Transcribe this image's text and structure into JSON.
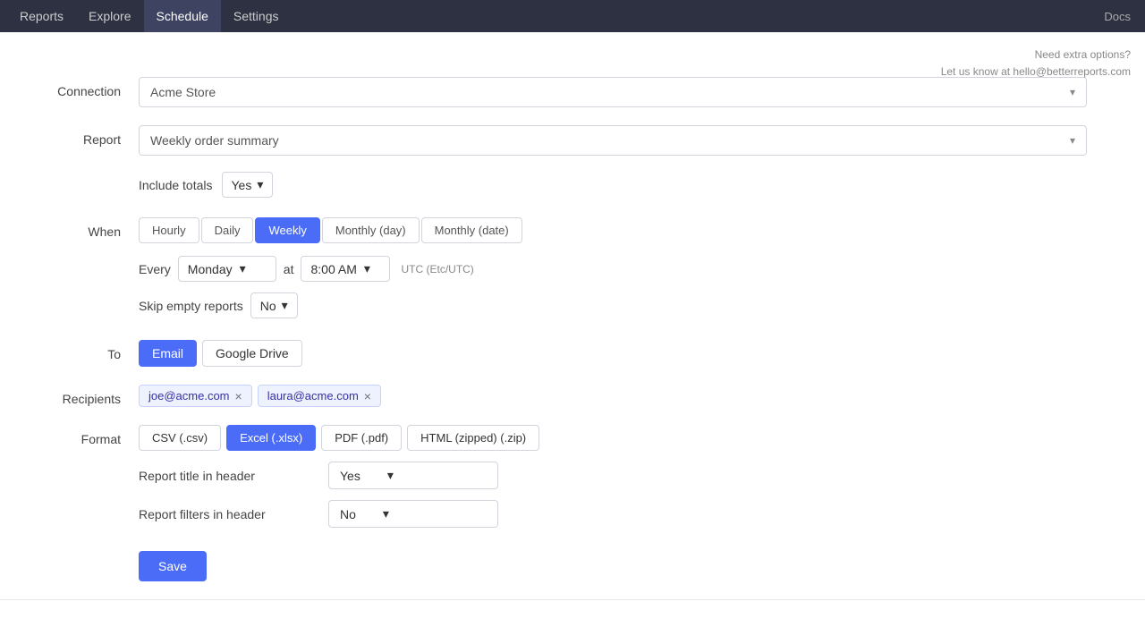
{
  "nav": {
    "items": [
      {
        "id": "reports",
        "label": "Reports",
        "active": false
      },
      {
        "id": "explore",
        "label": "Explore",
        "active": false
      },
      {
        "id": "schedule",
        "label": "Schedule",
        "active": true
      },
      {
        "id": "settings",
        "label": "Settings",
        "active": false
      }
    ],
    "right_label": "Docs"
  },
  "help": {
    "line1": "Need extra options?",
    "line2": "Let us know at hello@betterreports.com"
  },
  "form": {
    "connection_label": "Connection",
    "connection_value": "Acme Store",
    "report_label": "Report",
    "report_value": "Weekly order summary",
    "include_totals_label": "Include totals",
    "include_totals_value": "Yes",
    "when_label": "When",
    "when_tabs": [
      {
        "id": "hourly",
        "label": "Hourly",
        "active": false
      },
      {
        "id": "daily",
        "label": "Daily",
        "active": false
      },
      {
        "id": "weekly",
        "label": "Weekly",
        "active": true
      },
      {
        "id": "monthly_day",
        "label": "Monthly (day)",
        "active": false
      },
      {
        "id": "monthly_date",
        "label": "Monthly (date)",
        "active": false
      }
    ],
    "every_label": "Every",
    "every_value": "Monday",
    "at_label": "at",
    "time_value": "8:00 AM",
    "timezone_label": "UTC (Etc/UTC)",
    "skip_empty_label": "Skip empty reports",
    "skip_empty_value": "No",
    "to_label": "To",
    "to_buttons": [
      {
        "id": "email",
        "label": "Email",
        "active": true
      },
      {
        "id": "google_drive",
        "label": "Google Drive",
        "active": false
      }
    ],
    "recipients_label": "Recipients",
    "recipients": [
      {
        "email": "joe@acme.com"
      },
      {
        "email": "laura@acme.com"
      }
    ],
    "format_label": "Format",
    "format_buttons": [
      {
        "id": "csv",
        "label": "CSV (.csv)",
        "active": false
      },
      {
        "id": "excel",
        "label": "Excel (.xlsx)",
        "active": true
      },
      {
        "id": "pdf",
        "label": "PDF (.pdf)",
        "active": false
      },
      {
        "id": "html",
        "label": "HTML (zipped) (.zip)",
        "active": false
      }
    ],
    "report_title_header_label": "Report title in header",
    "report_title_header_value": "Yes",
    "report_filters_header_label": "Report filters in header",
    "report_filters_header_value": "No",
    "save_label": "Save"
  },
  "icons": {
    "chevron_down": "▾",
    "close": "×"
  }
}
